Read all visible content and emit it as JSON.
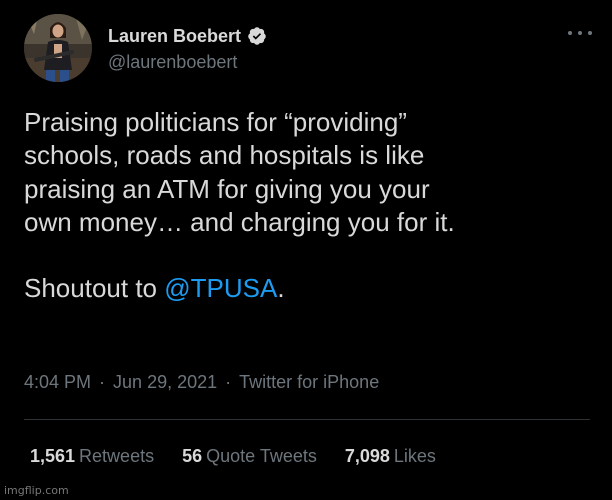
{
  "tweet": {
    "author": {
      "display_name": "Lauren Boebert",
      "handle": "@laurenboebert",
      "verified": true,
      "avatar_icon": "profile-photo-avatar"
    },
    "more_icon": "more-dots-icon",
    "text_lines": [
      "Praising politicians for “providing”",
      "schools, roads and hospitals is like",
      "praising an ATM for giving you your",
      "own money… and charging you for it."
    ],
    "shoutout_prefix": "Shoutout to ",
    "mention": "@TPUSA",
    "shoutout_suffix": ".",
    "time": "4:04 PM",
    "date": "Jun 29, 2021",
    "separator": "·",
    "source": "Twitter for iPhone",
    "stats": [
      {
        "value": "1,561",
        "label": "Retweets"
      },
      {
        "value": "56",
        "label": "Quote Tweets"
      },
      {
        "value": "7,098",
        "label": "Likes"
      }
    ]
  },
  "watermark": "imgflip.com",
  "colors": {
    "background": "#000000",
    "text": "#d9d9d9",
    "muted": "#6e767d",
    "link": "#1d9bf0",
    "verified_badge": "#d9d9d9",
    "divider": "#2f3336"
  }
}
